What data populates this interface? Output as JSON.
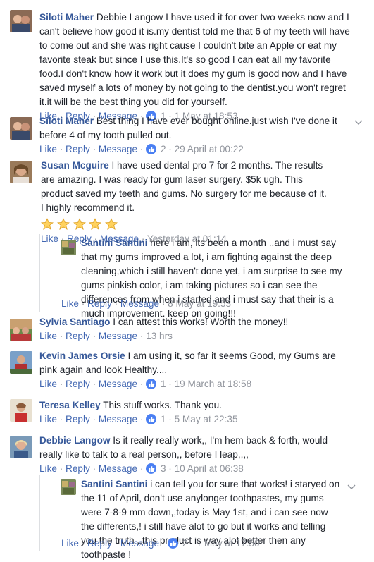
{
  "comments": [
    {
      "author": "Siloti Maher",
      "text": "Debbie Langow I have used it for over two weeks now and I can't believe how good it is.my dentist told me that 6 of my teeth will have to come out and she was right cause I couldn't bite an Apple or eat my favorite steak but since I use this.It's so good I can eat all my favorite food.I don't know how it work but it does my gum is good now and I have saved myself a lots of money by not going to the dentist.you won't regret it.it will be the best thing you did for yourself.",
      "like": "Like",
      "reply": "Reply",
      "message": "Message",
      "likes": "1",
      "time": "1 May at 18:53"
    },
    {
      "author": "Siloti Maher",
      "text": "Best thing I have ever bought online.just wish I've done it before 4 of my tooth pulled out.",
      "like": "Like",
      "reply": "Reply",
      "message": "Message",
      "likes": "2",
      "time": "29 April at 00:22"
    },
    {
      "author": "Susan Mcguire",
      "text": "I have used dental pro 7 for 2 months. The results are amazing. I was ready for gum laser surgery. $5k ugh. This product saved my teeth and gums. No surgery for me because of it.",
      "text2": "I highly recommend it.",
      "stars": 5,
      "like": "Like",
      "reply": "Reply",
      "message": "Message",
      "time": "Yesterday at 01:14"
    },
    {
      "author": "Santini Santini",
      "text": "here i am, its been a month ..and i must say that my gums improved a lot, i am fighting against the deep cleaning,which i still haven't done yet, i am surprise to see my gums pinkish color, i am taking pictures so i can see the differences from when i started and i must say that their is a much improvement. keep on going!!!",
      "like": "Like",
      "reply": "Reply",
      "message": "Message",
      "time": "8 May at 19:53"
    },
    {
      "author": "Sylvia Santiago",
      "text": "I can attest this works! Worth the money!!",
      "like": "Like",
      "reply": "Reply",
      "message": "Message",
      "time": "13 hrs"
    },
    {
      "author": "Kevin James Orsie",
      "text": "I am using it, so far it seems Good, my Gums are pink again and look Healthy....",
      "like": "Like",
      "reply": "Reply",
      "message": "Message",
      "likes": "1",
      "time": "19 March at 18:58"
    },
    {
      "author": "Teresa Kelley",
      "text": "This stuff works. Thank you.",
      "like": "Like",
      "reply": "Reply",
      "message": "Message",
      "likes": "1",
      "time": "5 May at 22:35"
    },
    {
      "author": "Debbie Langow",
      "text": "Is it really really work,, I'm hem back & forth, would really like to talk to a real person,, before I leap,,,,",
      "like": "Like",
      "reply": "Reply",
      "message": "Message",
      "likes": "3",
      "time": "10 April at 06:38"
    },
    {
      "author": "Santini Santini",
      "text": "i can tell you for sure that works! i staryed on the 11 of April, don't use anylonger toothpastes, my gums were 7-8-9 mm down,,today is May 1st, and i can see now the differents,! i still have alot to go but it works and telling you the truth ,,this product is way alot better then any toothpaste !",
      "like": "Like",
      "reply": "Reply",
      "message": "Message",
      "likes": "2",
      "time": "1 May at 17:50"
    }
  ],
  "separator": "·",
  "colors": {
    "name": "#365899",
    "link": "#4267b2",
    "meta": "#90949c",
    "like_badge": "#4a7ff2"
  }
}
